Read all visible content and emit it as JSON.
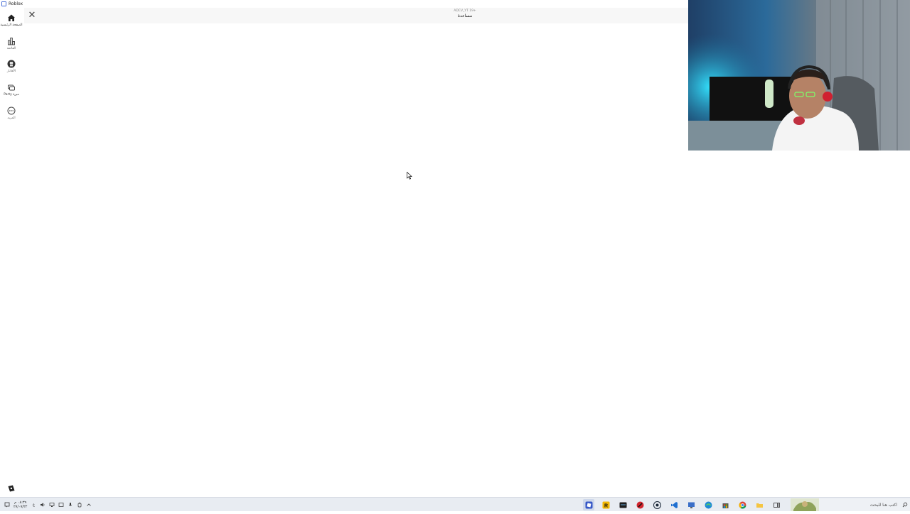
{
  "window": {
    "title": "Roblox"
  },
  "topbar": {
    "subtitle": "ADCV_YT 19+",
    "title": "مساعدة"
  },
  "sidebar": {
    "items": [
      {
        "id": "home",
        "label": "الصفحة الرئيسية",
        "icon": "home-icon"
      },
      {
        "id": "charts",
        "label": "القائمة",
        "icon": "charts-icon"
      },
      {
        "id": "avatar",
        "label": "الأفاتار",
        "icon": "avatar-icon"
      },
      {
        "id": "party",
        "label": "Party ميزة",
        "icon": "party-icon"
      },
      {
        "id": "more",
        "label": "المزيد",
        "icon": "more-icon"
      }
    ]
  },
  "taskbar": {
    "clock_time": "٠٨:٣٩ م",
    "clock_date": "٢٧/٠٧/٢٢",
    "search_placeholder": "اكتب هنا للبحث",
    "apps": [
      "roblox-app-icon",
      "rockstar-icon",
      "terminal-icon",
      "red-app-icon",
      "steam-icon",
      "vscode-icon",
      "monitor-icon",
      "edge-icon",
      "store-icon",
      "chrome-icon",
      "folder-icon",
      "taskview-icon"
    ]
  },
  "colors": {
    "accent": "#4a6fd8",
    "topbar_bg": "#f7f7f7",
    "taskbar_bg": "#e8ecf2"
  }
}
